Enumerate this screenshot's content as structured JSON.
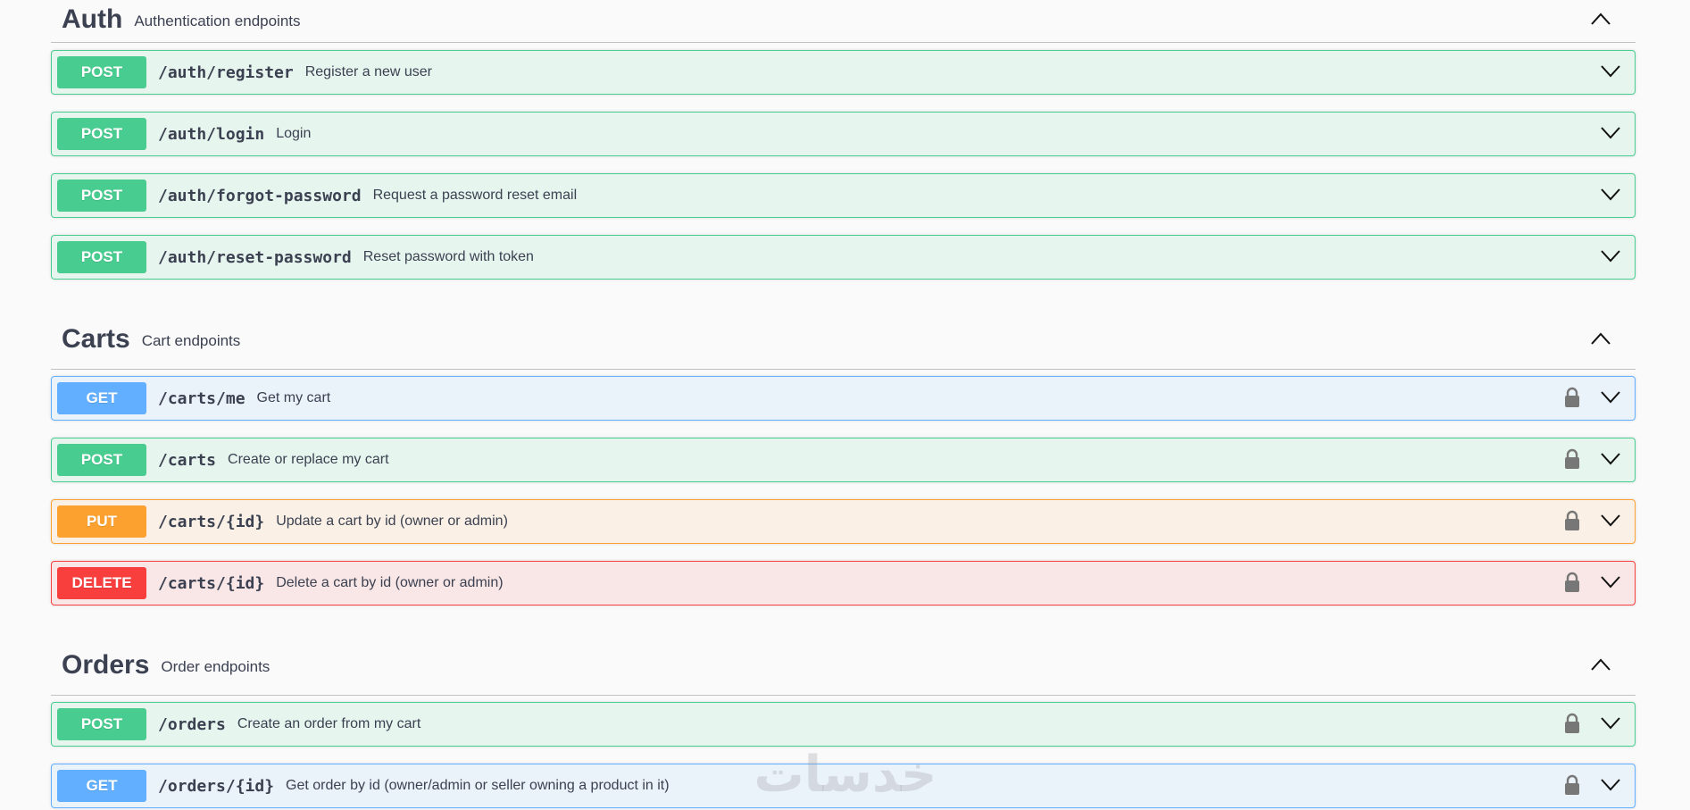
{
  "sections": [
    {
      "title": "Auth",
      "description": "Authentication endpoints",
      "toggle_icon": "chevron-up-icon",
      "operations": [
        {
          "method": "POST",
          "path": "/auth/register",
          "summary": "Register a new user",
          "locked": false
        },
        {
          "method": "POST",
          "path": "/auth/login",
          "summary": "Login",
          "locked": false
        },
        {
          "method": "POST",
          "path": "/auth/forgot-password",
          "summary": "Request a password reset email",
          "locked": false
        },
        {
          "method": "POST",
          "path": "/auth/reset-password",
          "summary": "Reset password with token",
          "locked": false
        }
      ]
    },
    {
      "title": "Carts",
      "description": "Cart endpoints",
      "toggle_icon": "chevron-up-icon",
      "operations": [
        {
          "method": "GET",
          "path": "/carts/me",
          "summary": "Get my cart",
          "locked": true
        },
        {
          "method": "POST",
          "path": "/carts",
          "summary": "Create or replace my cart",
          "locked": true
        },
        {
          "method": "PUT",
          "path": "/carts/{id}",
          "summary": "Update a cart by id (owner or admin)",
          "locked": true
        },
        {
          "method": "DELETE",
          "path": "/carts/{id}",
          "summary": "Delete a cart by id (owner or admin)",
          "locked": true
        }
      ]
    },
    {
      "title": "Orders",
      "description": "Order endpoints",
      "toggle_icon": "chevron-up-icon",
      "operations": [
        {
          "method": "POST",
          "path": "/orders",
          "summary": "Create an order from my cart",
          "locked": true
        },
        {
          "method": "GET",
          "path": "/orders/{id}",
          "summary": "Get order by id (owner/admin or seller owning a product in it)",
          "locked": true
        }
      ]
    }
  ],
  "watermark": "خدسات",
  "colors": {
    "post": "#49cc90",
    "get": "#61affe",
    "put": "#fca130",
    "delete": "#f93e3e",
    "text": "#3b4151"
  }
}
